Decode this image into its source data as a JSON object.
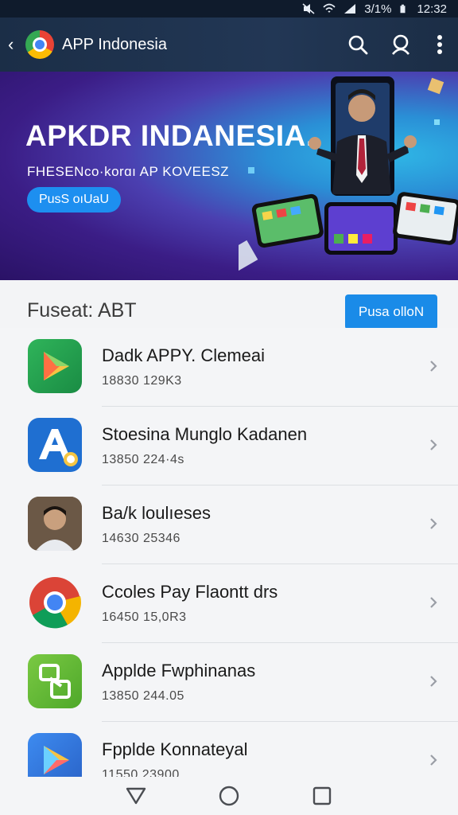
{
  "status_bar": {
    "signal_text": "3/1%",
    "time": "12:32"
  },
  "app_bar": {
    "back_glyph": "‹",
    "title": "APP Indonesia",
    "icons": [
      "search-icon",
      "account-search-icon",
      "more-vert-icon"
    ]
  },
  "banner": {
    "title": "APKDR INDANESIA.",
    "subtitle": "FHESENco·korɑı AP KOVEESZ",
    "button_label": "PusS oıUaU"
  },
  "section": {
    "title": "Fuseat: ABT",
    "button_label": "Pusa olloN"
  },
  "apps": [
    {
      "title": "Dadk APPY. Clemeai",
      "meta": "18830  129K3",
      "icon": "play-store-icon"
    },
    {
      "title": "Stoesina Munglo Kadanen",
      "meta": "13850  224·4s",
      "icon": "app-letter-a-icon"
    },
    {
      "title": "Ba/k loulıeses",
      "meta": "14630  25346",
      "icon": "person-photo-icon"
    },
    {
      "title": "Ccoles Pay Flaontt drs",
      "meta": "16450  15,0R3",
      "icon": "chrome-icon"
    },
    {
      "title": "Applde Fwphinanas",
      "meta": "13850  244.05",
      "icon": "green-app-icon"
    },
    {
      "title": "Fpplde Konnateyal",
      "meta": "11550.23900",
      "icon": "blue-play-icon"
    }
  ],
  "colors": {
    "accent": "#1a8be8",
    "appbar": "#1f3350",
    "hero_start": "#2a1266",
    "hero_end": "#2fb7e6"
  },
  "nav": [
    "back-triangle-icon",
    "home-circle-icon",
    "recents-square-icon"
  ]
}
